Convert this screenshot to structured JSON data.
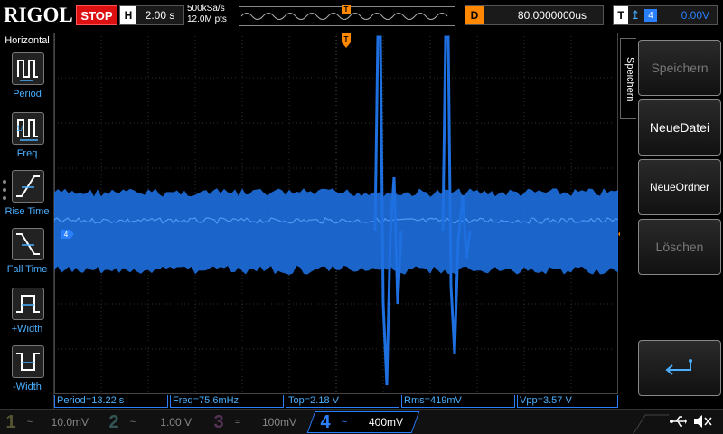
{
  "topbar": {
    "brand": "RIGOL",
    "run_state": "STOP",
    "horizontal_letter": "H",
    "timebase": "2.00 s",
    "sample_rate": "500kSa/s",
    "memory_depth": "12.0M pts",
    "trigger_marker": "T",
    "delay_letter": "D",
    "delay_value": "80.0000000us",
    "trigger_letter": "T",
    "trigger_source": "4",
    "trigger_level": "0.00V"
  },
  "leftbar": {
    "title": "Horizontal",
    "items": [
      {
        "label": "Period",
        "icon": "period-icon"
      },
      {
        "label": "Freq",
        "icon": "frequency-icon"
      },
      {
        "label": "Rise Time",
        "icon": "rise-time-icon"
      },
      {
        "label": "Fall Time",
        "icon": "fall-time-icon"
      },
      {
        "label": "+Width",
        "icon": "positive-width-icon"
      },
      {
        "label": "-Width",
        "icon": "negative-width-icon"
      }
    ]
  },
  "screen": {
    "channel_marker": "4",
    "trigger_marker_top": "T",
    "grid": true,
    "trace_color": "#1e6fe0",
    "trace_highlight": "#5aa8ff"
  },
  "rightbar": {
    "menu_title": "Speichern",
    "buttons": [
      {
        "label": "Speichern",
        "enabled": false
      },
      {
        "label": "NeueDatei",
        "enabled": true
      },
      {
        "label": "NeueOrdner",
        "enabled": true
      },
      {
        "label": "Löschen",
        "enabled": false
      },
      {
        "label": "",
        "icon": "enter-return-icon",
        "enabled": true
      }
    ]
  },
  "measurements": [
    {
      "text": "Period=13.22 s"
    },
    {
      "text": "Freq=75.6mHz"
    },
    {
      "text": "Top=2.18 V"
    },
    {
      "text": "Rms=419mV"
    },
    {
      "text": "Vpp=3.57 V"
    }
  ],
  "channels": [
    {
      "num": "1",
      "coupling": "~",
      "scale": "10.0mV",
      "color": "#555533"
    },
    {
      "num": "2",
      "coupling": "~",
      "scale": "1.00 V",
      "color": "#335555"
    },
    {
      "num": "3",
      "coupling": "=",
      "scale": "100mV",
      "color": "#553355"
    },
    {
      "num": "4",
      "coupling": "~",
      "scale": "400mV",
      "color": "#2a7fff"
    }
  ],
  "status_icons": [
    "usb-icon",
    "speaker-muted-icon"
  ],
  "colors": {
    "accent_blue": "#2a7fff",
    "trigger_orange": "#ff8800",
    "stop_red": "#dd1111"
  }
}
